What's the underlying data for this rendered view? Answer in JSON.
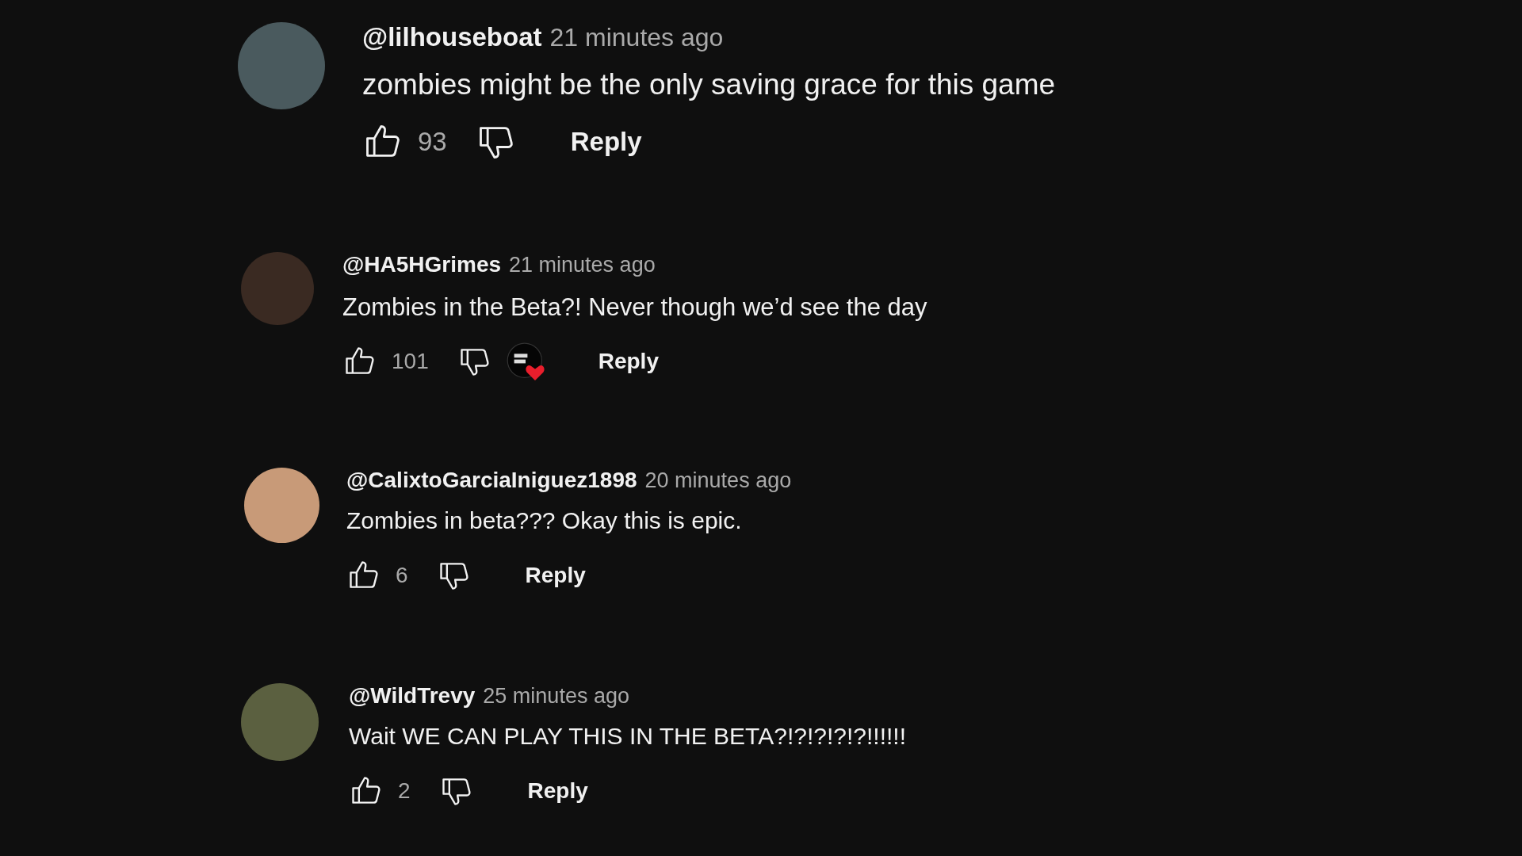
{
  "comments": [
    {
      "username": "@lilhouseboat",
      "time": "21 minutes ago",
      "text": "zombies might be the only saving grace for this game",
      "likes": "93",
      "reply": "Reply",
      "liked_by_creator": false
    },
    {
      "username": "@HA5HGrimes",
      "time": "21 minutes ago",
      "text": "Zombies in the Beta?! Never though we’d see the day",
      "likes": "101",
      "reply": "Reply",
      "liked_by_creator": true
    },
    {
      "username": "@CalixtoGarciaIniguez1898",
      "time": "20 minutes ago",
      "text": "Zombies in beta??? Okay this is epic.",
      "likes": "6",
      "reply": "Reply",
      "liked_by_creator": false
    },
    {
      "username": "@WildTrevy",
      "time": "25 minutes ago",
      "text": "Wait WE CAN PLAY THIS IN THE BETA?!?!?!?!?!!!!!!",
      "likes": "2",
      "reply": "Reply",
      "liked_by_creator": false
    }
  ]
}
